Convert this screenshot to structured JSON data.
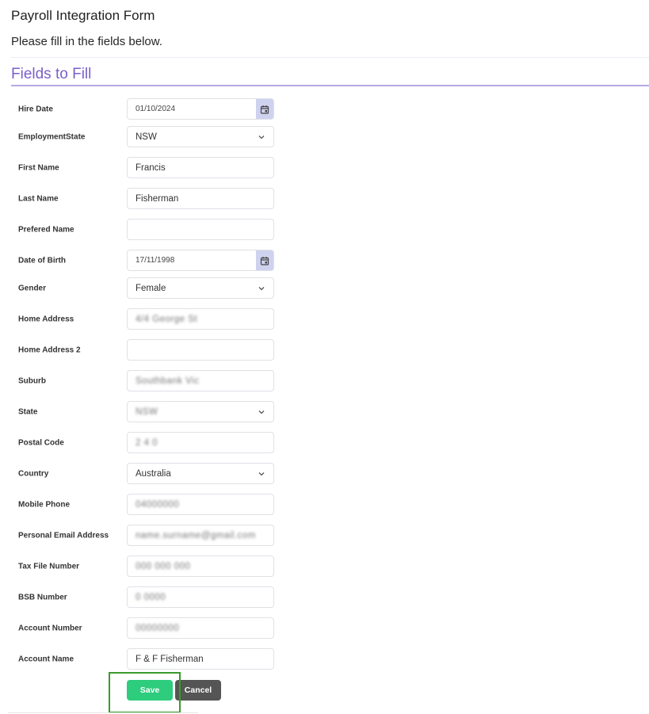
{
  "header": {
    "title": "Payroll Integration Form",
    "subtitle": "Please fill in the fields below."
  },
  "section": {
    "title": "Fields to Fill",
    "accent_color": "#7a5fc9"
  },
  "fields": [
    {
      "label": "Hire Date",
      "type": "date",
      "value": "01/10/2024",
      "icon": "calendar-icon"
    },
    {
      "label": "EmploymentState",
      "type": "select",
      "value": "NSW",
      "icon": "chevron-down-icon"
    },
    {
      "label": "First Name",
      "type": "text",
      "value": "Francis"
    },
    {
      "label": "Last Name",
      "type": "text",
      "value": "Fisherman"
    },
    {
      "label": "Prefered Name",
      "type": "text",
      "value": ""
    },
    {
      "label": "Date of Birth",
      "type": "date",
      "value": "17/11/1998",
      "icon": "calendar-icon"
    },
    {
      "label": "Gender",
      "type": "select",
      "value": "Female",
      "icon": "chevron-down-icon"
    },
    {
      "label": "Home Address",
      "type": "text",
      "value": "[redacted]",
      "redacted": true
    },
    {
      "label": "Home Address 2",
      "type": "text",
      "value": ""
    },
    {
      "label": "Suburb",
      "type": "text",
      "value": "[redacted]",
      "redacted": true
    },
    {
      "label": "State",
      "type": "select",
      "value": "[redacted]",
      "redacted": true,
      "icon": "chevron-down-icon"
    },
    {
      "label": "Postal Code",
      "type": "text",
      "value": "[redacted]",
      "redacted": true
    },
    {
      "label": "Country",
      "type": "select",
      "value": "Australia",
      "icon": "chevron-down-icon"
    },
    {
      "label": "Mobile Phone",
      "type": "text",
      "value": "[redacted]",
      "redacted": true
    },
    {
      "label": "Personal Email Address",
      "type": "text",
      "value": "[redacted]",
      "redacted": true
    },
    {
      "label": "Tax File Number",
      "type": "text",
      "value": "[redacted]",
      "redacted": true
    },
    {
      "label": "BSB Number",
      "type": "text",
      "value": "[redacted]",
      "redacted": true
    },
    {
      "label": "Account Number",
      "type": "text",
      "value": "[redacted]",
      "redacted": true
    },
    {
      "label": "Account Name",
      "type": "text",
      "value": "F & F Fisherman"
    }
  ],
  "blur_placeholders": {
    "Home Address": "4/4 George St",
    "Suburb": "Southbank Vic",
    "State": "NSW",
    "Postal Code": "2 4 0",
    "Mobile Phone": "04000000",
    "Personal Email Address": "name.surname@gmail.com",
    "Tax File Number": "000 000 000",
    "BSB Number": "0 0000",
    "Account Number": "00000000"
  },
  "actions": {
    "save_label": "Save",
    "cancel_label": "Cancel",
    "save_color": "#2ecc7d",
    "cancel_color": "#555555",
    "highlight_color": "#3a9a2b"
  }
}
